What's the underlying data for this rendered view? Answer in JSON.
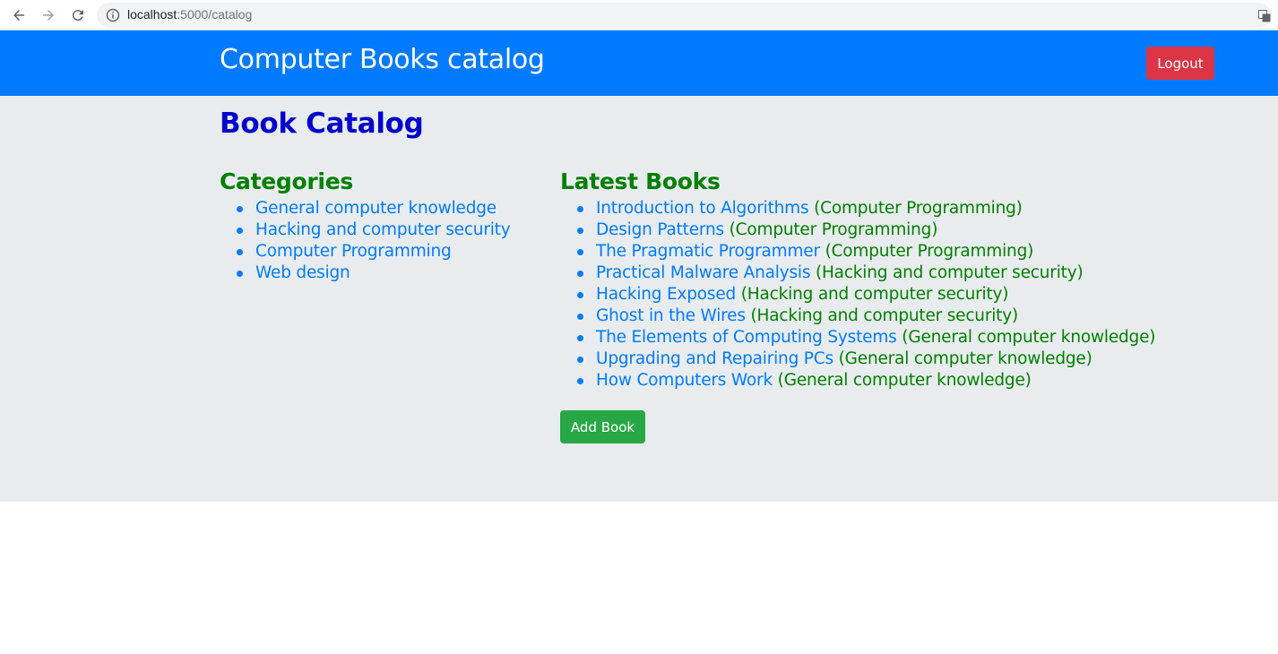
{
  "browser": {
    "url_host": "localhost",
    "url_path": ":5000/catalog"
  },
  "header": {
    "title": "Computer Books catalog",
    "logout_label": "Logout"
  },
  "main": {
    "heading": "Book Catalog",
    "categories": {
      "heading": "Categories",
      "items": [
        "General computer knowledge",
        "Hacking and computer security",
        "Computer Programming",
        "Web design"
      ]
    },
    "latest_books": {
      "heading": "Latest Books",
      "items": [
        {
          "title": "Introduction to Algorithms",
          "category": "(Computer Programming)"
        },
        {
          "title": "Design Patterns",
          "category": "(Computer Programming)"
        },
        {
          "title": "The Pragmatic Programmer",
          "category": "(Computer Programming)"
        },
        {
          "title": "Practical Malware Analysis",
          "category": "(Hacking and computer security)"
        },
        {
          "title": "Hacking Exposed",
          "category": "(Hacking and computer security)"
        },
        {
          "title": "Ghost in the Wires",
          "category": "(Hacking and computer security)"
        },
        {
          "title": "The Elements of Computing Systems",
          "category": "(General computer knowledge)"
        },
        {
          "title": "Upgrading and Repairing PCs",
          "category": "(General computer knowledge)"
        },
        {
          "title": "How Computers Work",
          "category": "(General computer knowledge)"
        }
      ]
    },
    "add_book_label": "Add Book"
  },
  "colors": {
    "header_bg": "#007bff",
    "logout_bg": "#dc3545",
    "add_bg": "#28a745",
    "link": "#007bff",
    "section_heading": "#008000",
    "page_heading": "#0000cd",
    "main_bg": "#e9ecef"
  },
  "icons": [
    "back-arrow-icon",
    "forward-arrow-icon",
    "reload-icon",
    "info-icon",
    "translate-icon"
  ]
}
